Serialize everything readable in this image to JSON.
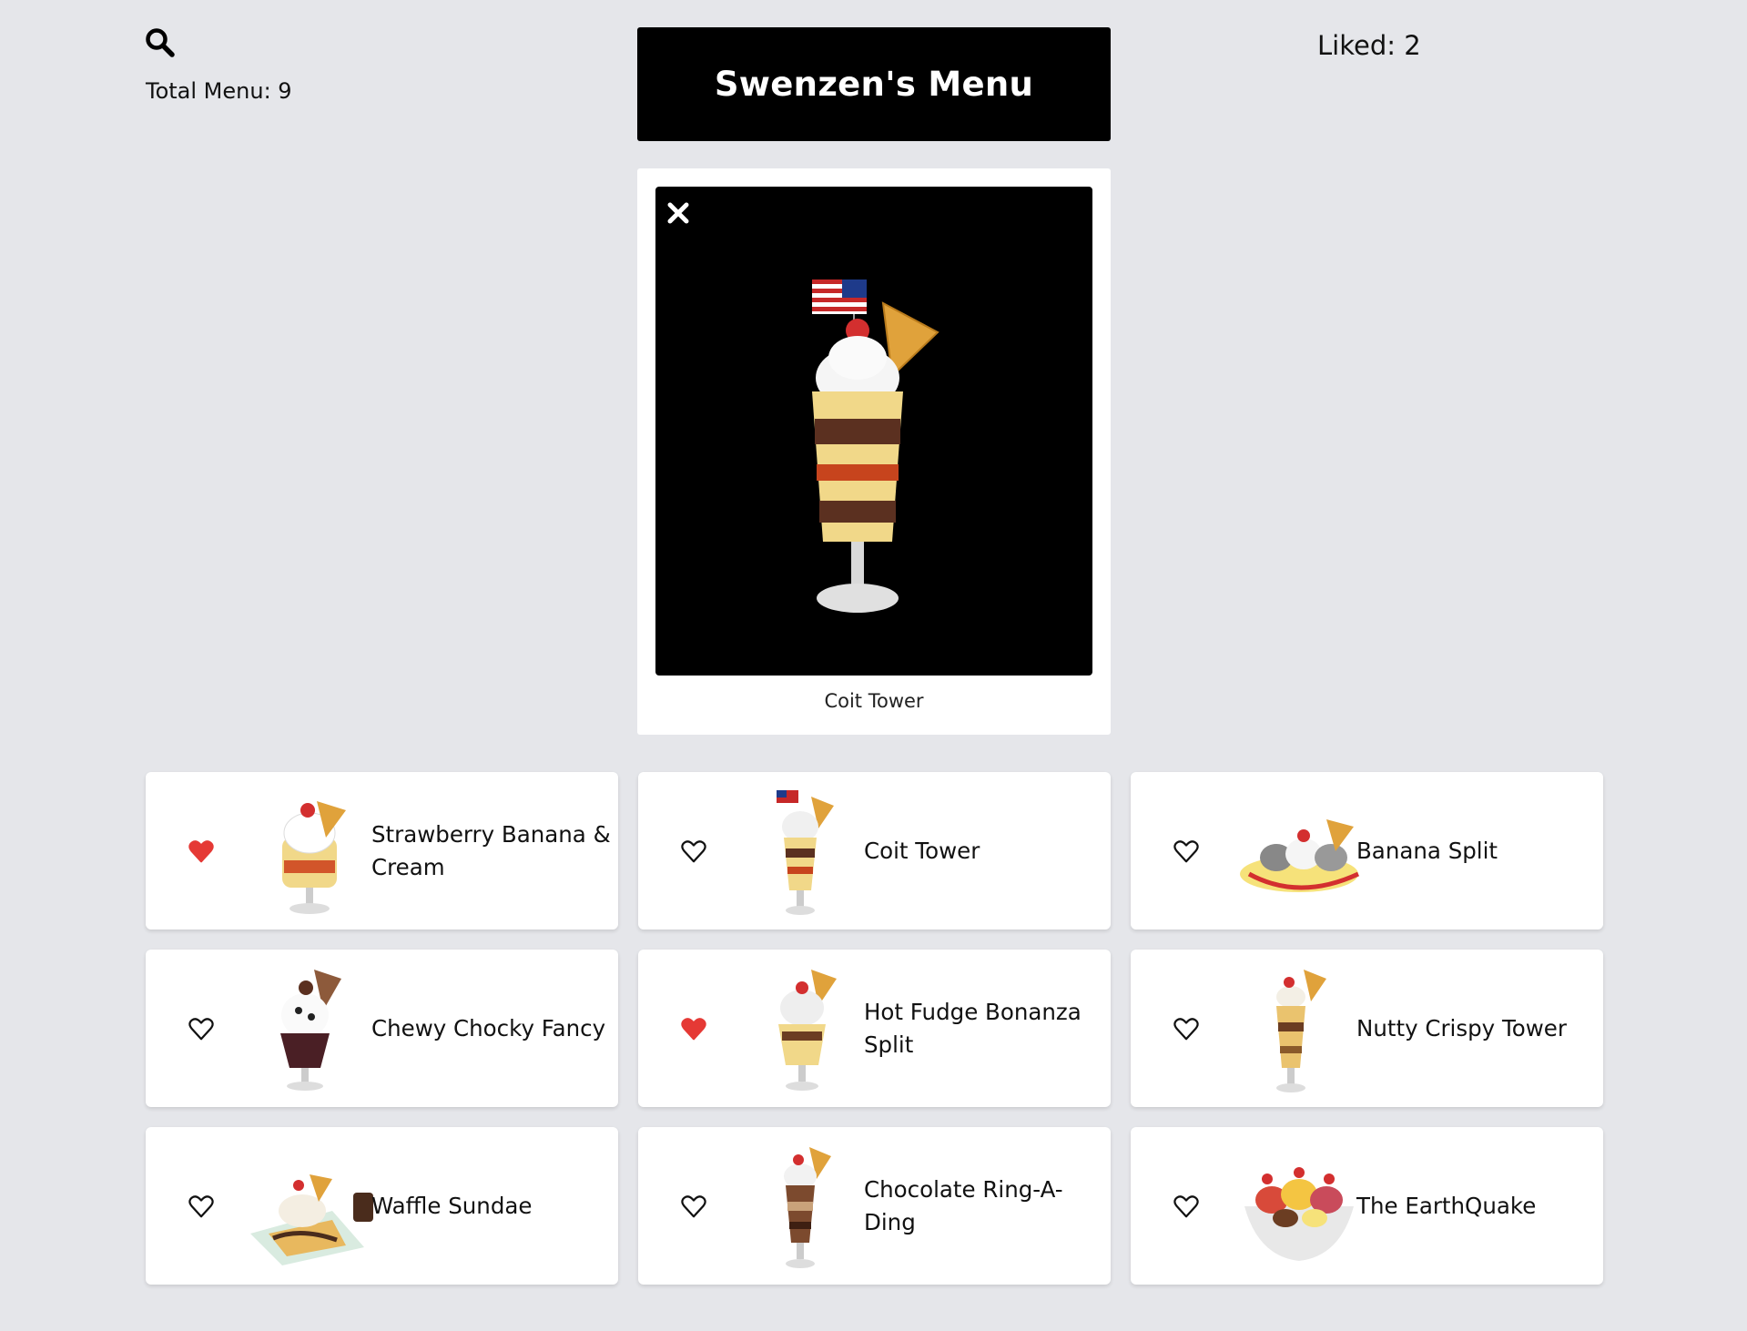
{
  "header": {
    "search_icon": "search-icon",
    "total_menu_label": "Total Menu: 9",
    "title": "Swenzen's Menu",
    "liked_label": "Liked: 2"
  },
  "preview": {
    "close_icon": "close-icon",
    "caption": "Coit Tower"
  },
  "colors": {
    "background": "#e5e6ea",
    "title_bg": "#000000",
    "card_bg": "#ffffff",
    "liked_heart": "#e53935",
    "text": "#111111"
  },
  "menu_items": [
    {
      "name": "Strawberry Banana & Cream",
      "liked": true
    },
    {
      "name": "Coit Tower",
      "liked": false
    },
    {
      "name": "Banana Split",
      "liked": false
    },
    {
      "name": "Chewy Chocky Fancy",
      "liked": false
    },
    {
      "name": "Hot Fudge Bonanza Split",
      "liked": true
    },
    {
      "name": "Nutty Crispy Tower",
      "liked": false
    },
    {
      "name": "Waffle Sundae",
      "liked": false
    },
    {
      "name": "Chocolate Ring-A-Ding",
      "liked": false
    },
    {
      "name": "The EarthQuake",
      "liked": false
    }
  ]
}
